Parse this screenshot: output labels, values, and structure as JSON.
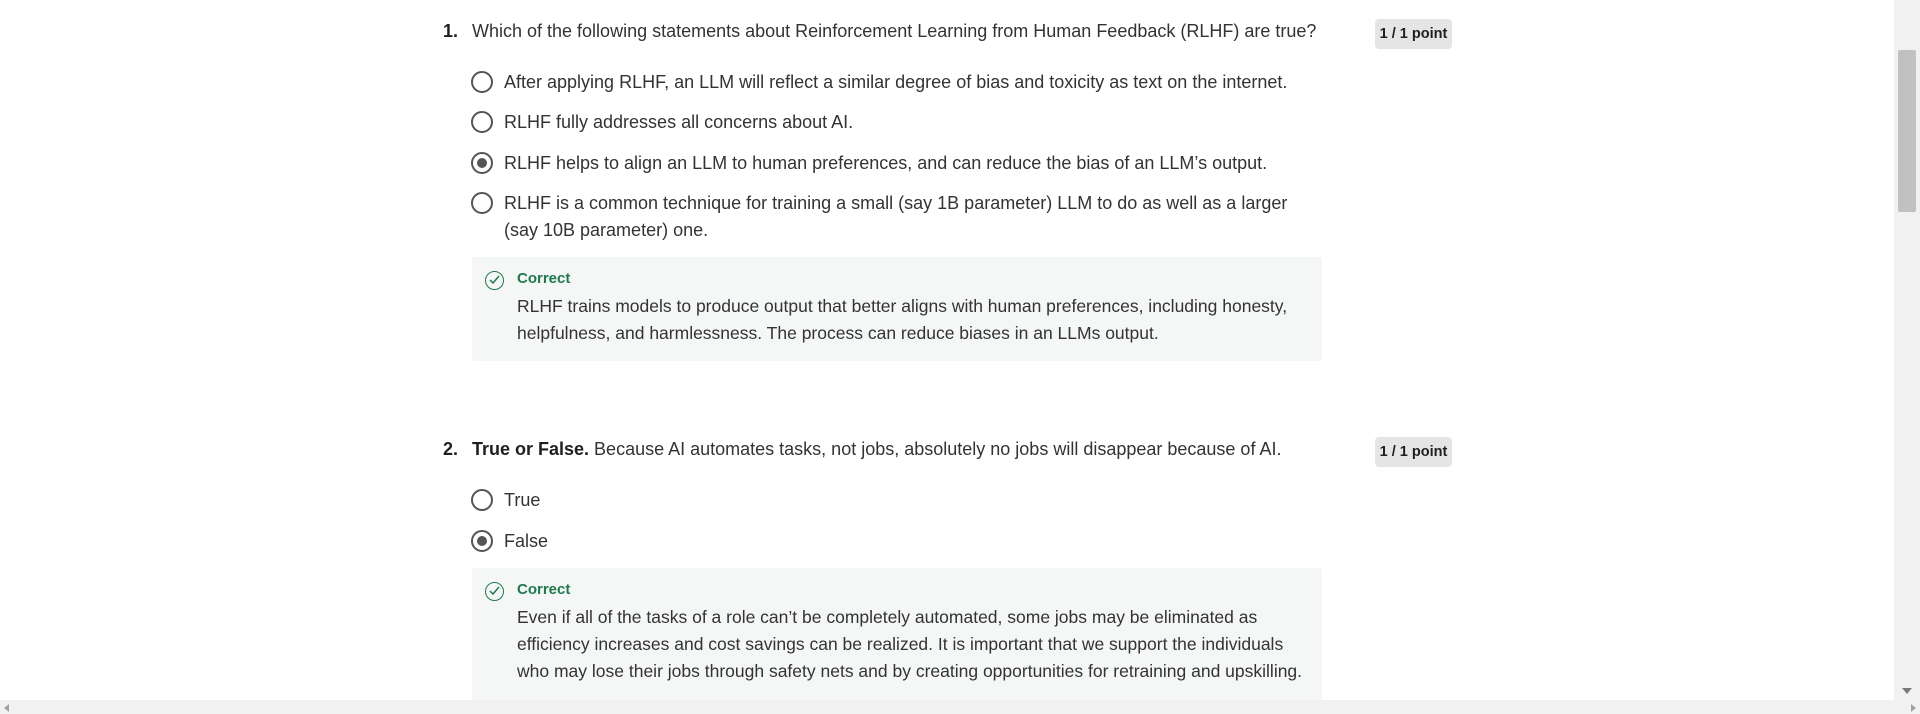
{
  "questions": [
    {
      "number": "1.",
      "prefix": "",
      "text": "Which of the following statements about Reinforcement Learning from Human Feedback (RLHF) are true?",
      "points": "1 / 1 point",
      "options": [
        {
          "label": "After applying RLHF, an LLM will reflect a similar degree of bias and toxicity as text on the internet.",
          "selected": false
        },
        {
          "label": "RLHF fully addresses all concerns about AI.",
          "selected": false
        },
        {
          "label": "RLHF helps to align an LLM to human preferences, and can reduce the bias of an LLM’s output.",
          "selected": true
        },
        {
          "label": "RLHF is a common technique for training a small (say 1B parameter) LLM to do as well as a larger (say 10B parameter) one.",
          "selected": false
        }
      ],
      "feedback": {
        "title": "Correct",
        "text": "RLHF trains models to produce output that better aligns with human preferences, including honesty, helpfulness, and harmlessness. The process can reduce biases in an LLMs output."
      }
    },
    {
      "number": "2.",
      "prefix": "True or False.",
      "text": " Because AI automates tasks, not jobs, absolutely no jobs will disappear because of AI.",
      "points": "1 / 1 point",
      "options": [
        {
          "label": "True",
          "selected": false
        },
        {
          "label": "False",
          "selected": true
        }
      ],
      "feedback": {
        "title": "Correct",
        "text": "Even if all of the tasks of a role can’t be completely automated, some jobs may be eliminated as efficiency increases and cost savings can be realized. It is important that we support the individuals who may lose their jobs through safety nets and by creating opportunities for retraining and upskilling."
      }
    }
  ],
  "colors": {
    "correct": "#1f7a4d",
    "feedback_bg": "#f4f7f6",
    "points_bg": "#e5e5e5"
  }
}
